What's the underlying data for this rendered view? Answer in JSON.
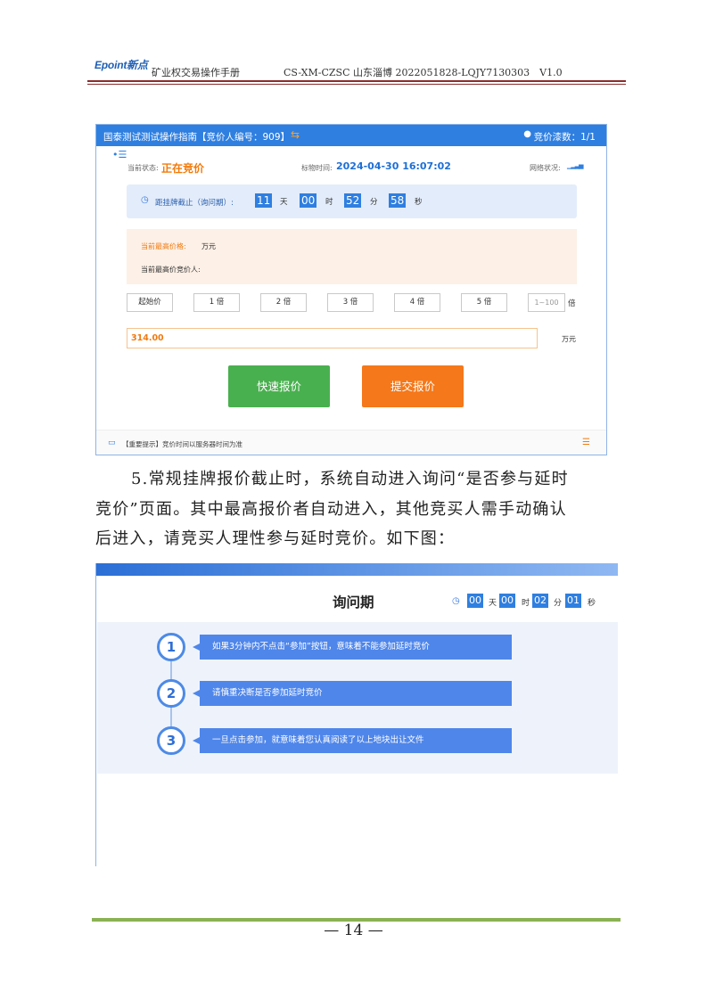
{
  "header": {
    "logo": "Epoint新点",
    "manual_title": "矿业权交易操作手册",
    "doc_code": "CS-XM-CZSC 山东淄博 2022051828-LQJY7130303　V1.0"
  },
  "screenshot1": {
    "top_title": "国泰测试测试操作指南【竞价人编号：909】",
    "top_swap_icon": "swap-icon",
    "top_user_icon": "user-icon",
    "top_count": "竞价漆数：1/1",
    "status_label": "当前状态:",
    "status_value": "正在竞价",
    "time_label": "标物时间:",
    "time_value": "2024-04-30 16:07:02",
    "network_label": "网络状况:",
    "network_icon": "signal-icon",
    "countdown": {
      "label": "距挂牌截止（询问期）:",
      "days": "11",
      "days_unit": "天",
      "hours": "00",
      "hours_unit": "时",
      "minutes": "52",
      "minutes_unit": "分",
      "seconds": "58",
      "seconds_unit": "秒"
    },
    "highest_price_label": "当前最高价格:",
    "highest_price_unit": "万元",
    "highest_bidder_label": "当前最高价竞价人:",
    "multipliers": [
      "起始价",
      "1 倍",
      "2 倍",
      "3 倍",
      "4 倍",
      "5 倍"
    ],
    "multiplier_input_placeholder": "1~100",
    "multiplier_unit": "倍",
    "price_value": "314.00",
    "price_unit": "万元",
    "quick_bid_label": "快速报价",
    "submit_bid_label": "提交报价",
    "footer_tip": "【重要提示】竞价时间以服务器时间为准",
    "colors": {
      "primary": "#2f7fe0",
      "orange": "#f5781a",
      "green": "#49b04f"
    }
  },
  "paragraph": {
    "line1": "5.常规挂牌报价截止时，系统自动进入询问“是否参与延时",
    "line2": "竞价”页面。其中最高报价者自动进入，其他竞买人需手动确认",
    "line3": "后进入，请竞买人理性参与延时竞价。如下图："
  },
  "screenshot2": {
    "title": "询问期",
    "clock_icon": "clock-icon",
    "days": "00",
    "days_unit": "天",
    "hours": "00",
    "hours_unit": "时",
    "minutes": "02",
    "minutes_unit": "分",
    "seconds": "01",
    "seconds_unit": "秒",
    "steps": [
      {
        "num": "1",
        "text": "如果3分钟内不点击“参加”按钮，意味着不能参加延时竞价"
      },
      {
        "num": "2",
        "text": "请慎重决断是否参加延时竞价"
      },
      {
        "num": "3",
        "text": "一旦点击参加，就意味着您认真阅读了以上地块出让文件"
      }
    ]
  },
  "footer": {
    "page_number": "— 14 —"
  }
}
